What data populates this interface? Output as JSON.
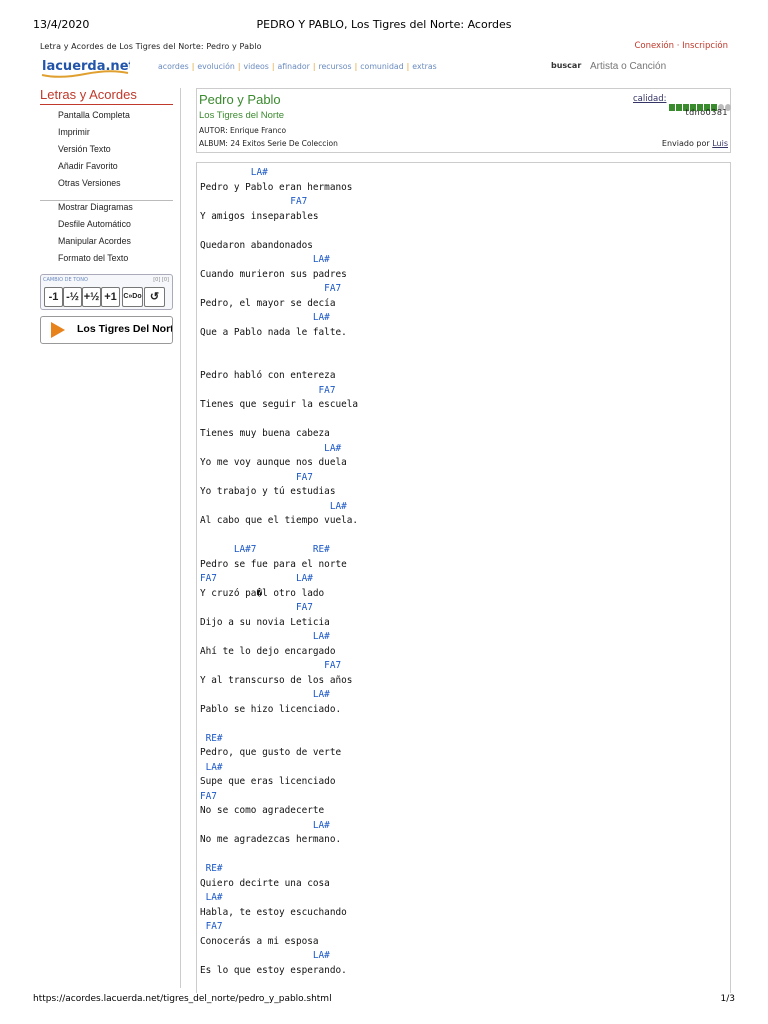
{
  "print_header": {
    "date": "13/4/2020",
    "title": "PEDRO Y PABLO, Los Tigres del Norte: Acordes"
  },
  "print_footer": {
    "url": "https://acordes.lacuerda.net/tigres_del_norte/pedro_y_pablo.shtml",
    "page": "1/3"
  },
  "breadcrumb": "Letra y Acordes de Los Tigres del Norte: Pedro y Pablo",
  "login": "Conexión · Inscripción",
  "logo": "lacuerda.net",
  "nav": [
    "acordes",
    "evolución",
    "videos",
    "afinador",
    "recursos",
    "comunidad",
    "extras"
  ],
  "search": {
    "label": "buscar",
    "placeholder": "Artista o Canción"
  },
  "sidebar": {
    "title": "Letras y Acordes",
    "menu1": [
      "Pantalla Completa",
      "Imprimir",
      "Versión Texto",
      "Añadir Favorito",
      "Otras Versiones"
    ],
    "menu2": [
      "Mostrar Diagramas",
      "Desfile Automático",
      "Manipular Acordes",
      "Formato del Texto"
    ],
    "tone": {
      "label": "CAMBIO DE TONO",
      "index": "[0] [0]",
      "buttons": [
        "-1",
        "-½",
        "+½",
        "+1",
        "C»Do",
        "↺"
      ]
    },
    "player": "Los Tigres Del Norte"
  },
  "song": {
    "title": "Pedro y Pablo",
    "artist": "Los Tigres del Norte",
    "autor": "AUTOR: Enrique Franco",
    "album": "ALBUM: 24 Exitos Serie De Coleccion",
    "calidad_label": "calidad:",
    "calidad": 0.875,
    "code": "tdno0381",
    "enviado_label": "Enviado por",
    "enviado_user": "Luis"
  },
  "lyrics": [
    {
      "t": "c",
      "s": "         LA#"
    },
    {
      "t": "l",
      "s": "Pedro y Pablo eran hermanos"
    },
    {
      "t": "c",
      "s": "                FA7"
    },
    {
      "t": "l",
      "s": "Y amigos inseparables"
    },
    {
      "t": "b",
      "s": ""
    },
    {
      "t": "l",
      "s": "Quedaron abandonados"
    },
    {
      "t": "c",
      "s": "                    LA#"
    },
    {
      "t": "l",
      "s": "Cuando murieron sus padres"
    },
    {
      "t": "c",
      "s": "                      FA7"
    },
    {
      "t": "l",
      "s": "Pedro, el mayor se decía"
    },
    {
      "t": "c",
      "s": "                    LA#"
    },
    {
      "t": "l",
      "s": "Que a Pablo nada le falte."
    },
    {
      "t": "b",
      "s": ""
    },
    {
      "t": "b",
      "s": ""
    },
    {
      "t": "l",
      "s": "Pedro habló con entereza"
    },
    {
      "t": "c",
      "s": "                     FA7"
    },
    {
      "t": "l",
      "s": "Tienes que seguir la escuela"
    },
    {
      "t": "b",
      "s": ""
    },
    {
      "t": "l",
      "s": "Tienes muy buena cabeza"
    },
    {
      "t": "c",
      "s": "                      LA#"
    },
    {
      "t": "l",
      "s": "Yo me voy aunque nos duela"
    },
    {
      "t": "c",
      "s": "                 FA7"
    },
    {
      "t": "l",
      "s": "Yo trabajo y tú estudias"
    },
    {
      "t": "c",
      "s": "                       LA#"
    },
    {
      "t": "l",
      "s": "Al cabo que el tiempo vuela."
    },
    {
      "t": "b",
      "s": ""
    },
    {
      "t": "c",
      "s": "      LA#7          RE#"
    },
    {
      "t": "l",
      "s": "Pedro se fue para el norte"
    },
    {
      "t": "c",
      "s": "FA7              LA#"
    },
    {
      "t": "l",
      "s": "Y cruzó pa�l otro lado"
    },
    {
      "t": "c",
      "s": "                 FA7"
    },
    {
      "t": "l",
      "s": "Dijo a su novia Leticia"
    },
    {
      "t": "c",
      "s": "                    LA#"
    },
    {
      "t": "l",
      "s": "Ahí te lo dejo encargado"
    },
    {
      "t": "c",
      "s": "                      FA7"
    },
    {
      "t": "l",
      "s": "Y al transcurso de los años"
    },
    {
      "t": "c",
      "s": "                    LA#"
    },
    {
      "t": "l",
      "s": "Pablo se hizo licenciado."
    },
    {
      "t": "b",
      "s": ""
    },
    {
      "t": "c",
      "s": " RE#"
    },
    {
      "t": "l",
      "s": "Pedro, que gusto de verte"
    },
    {
      "t": "c",
      "s": " LA#"
    },
    {
      "t": "l",
      "s": "Supe que eras licenciado"
    },
    {
      "t": "c",
      "s": "FA7"
    },
    {
      "t": "l",
      "s": "No se como agradecerte"
    },
    {
      "t": "c",
      "s": "                    LA#"
    },
    {
      "t": "l",
      "s": "No me agradezcas hermano."
    },
    {
      "t": "b",
      "s": ""
    },
    {
      "t": "c",
      "s": " RE#"
    },
    {
      "t": "l",
      "s": "Quiero decirte una cosa"
    },
    {
      "t": "c",
      "s": " LA#"
    },
    {
      "t": "l",
      "s": "Habla, te estoy escuchando"
    },
    {
      "t": "c",
      "s": " FA7"
    },
    {
      "t": "l",
      "s": "Conocerás a mi esposa"
    },
    {
      "t": "c",
      "s": "                    LA#"
    },
    {
      "t": "l",
      "s": "Es lo que estoy esperando."
    }
  ],
  "colors": {
    "accent_red": "#c0392b",
    "title_green": "#3a8a2e",
    "chord_blue": "#1a57c7",
    "nav_blue": "#6a8bbf",
    "nav_sep": "#e0a030",
    "player_orange": "#e8821a"
  }
}
